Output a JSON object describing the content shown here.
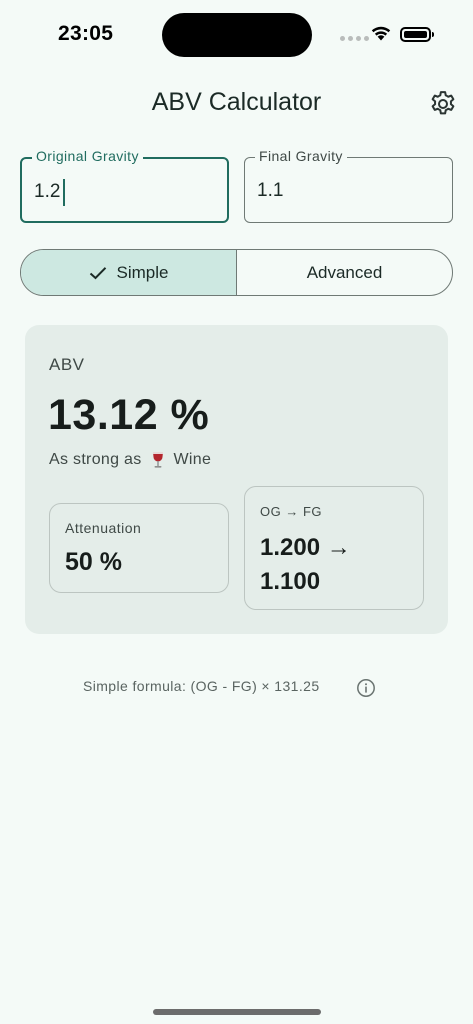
{
  "status_bar": {
    "time": "23:05"
  },
  "header": {
    "title": "ABV Calculator",
    "settings_icon": "gear-icon"
  },
  "inputs": {
    "original_gravity": {
      "label": "Original Gravity",
      "value": "1.2"
    },
    "final_gravity": {
      "label": "Final Gravity",
      "value": "1.1"
    }
  },
  "mode_toggle": {
    "options": [
      "Simple",
      "Advanced"
    ],
    "selected": "Simple",
    "check_icon": "check-icon"
  },
  "result": {
    "label": "ABV",
    "value": "13.12 %",
    "strength_prefix": "As strong as",
    "strength_icon": "wine-glass-icon",
    "strength_name": "Wine",
    "attenuation": {
      "label": "Attenuation",
      "value": "50 %"
    },
    "gravity_change": {
      "label": "OG → FG",
      "value": "1.200 → 1.100"
    }
  },
  "footer": {
    "formula": "Simple formula: (OG - FG) × 131.25",
    "info_icon": "info-icon"
  },
  "colors": {
    "background": "#f4faf7",
    "accent": "#206c5f",
    "selected_segment": "#cde8e1",
    "card": "#e4ede9"
  }
}
